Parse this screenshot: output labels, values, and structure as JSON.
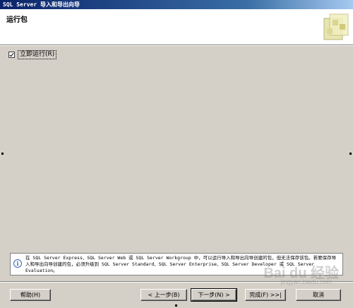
{
  "window": {
    "title": "SQL Server 导入和导出向导"
  },
  "header": {
    "title": "运行包",
    "logo_icon": "wizard-logo-icon"
  },
  "options": {
    "run_immediately": {
      "label": "立即运行(R)",
      "checked": true
    }
  },
  "info": {
    "icon": "info-icon",
    "text": "在 SQL Server Express、SQL Server Web 或 SQL Server Workgroup 中，可以运行导入和导出向导创建的包，但无法保存该包。若要保存导入和导出向导创建的包，必须升级到 SQL Server Standard、SQL Server Enterprise、SQL Server Developer 或 SQL Server Evaluation。"
  },
  "buttons": {
    "help": "帮助(H)",
    "back": "< 上一步(B)",
    "next": "下一步(N) >",
    "finish": "完成(F) >>|",
    "cancel": "取消"
  },
  "watermark": {
    "brand": "Bai du 经验",
    "url": "jingyan.baidu.com"
  },
  "colors": {
    "titlebar_start": "#0a246a",
    "face": "#d4d0c8",
    "header_bg": "#ffffff"
  }
}
